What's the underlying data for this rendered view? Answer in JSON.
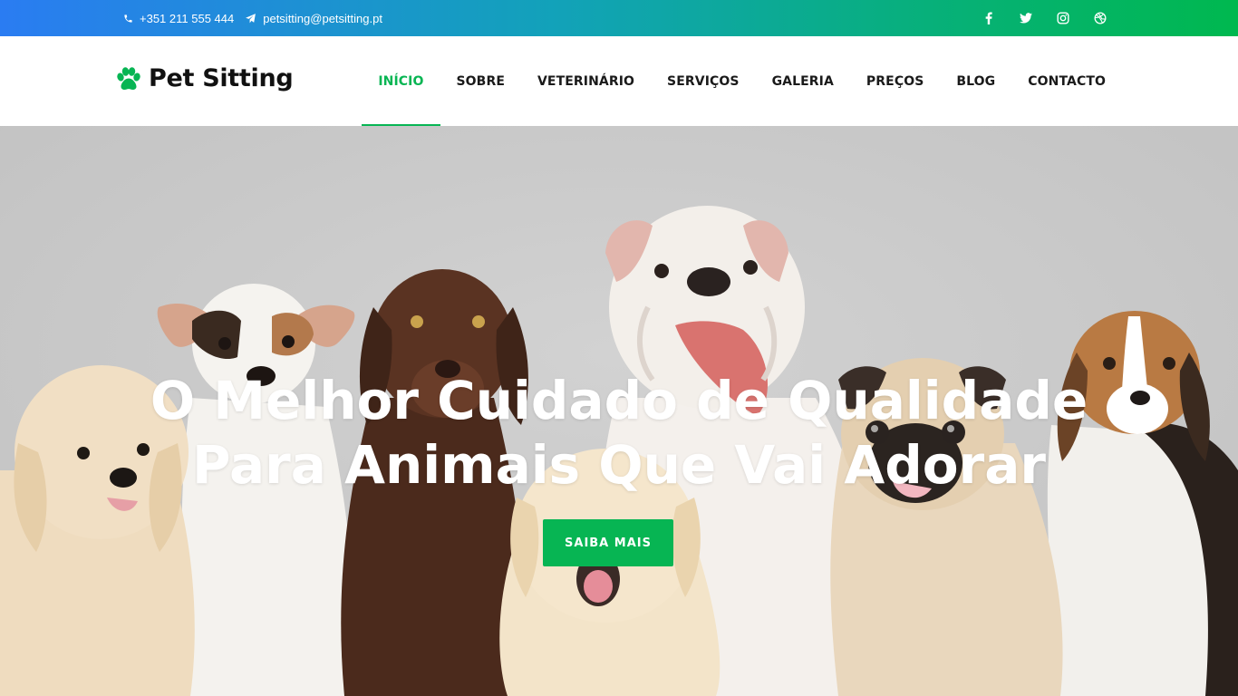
{
  "topbar": {
    "phone": "+351 211 555 444",
    "email": "petsitting@petsitting.pt",
    "social": [
      "facebook-icon",
      "twitter-icon",
      "instagram-icon",
      "dribbble-icon"
    ]
  },
  "header": {
    "logo_text": "Pet Sitting",
    "nav": [
      "INÍCIO",
      "SOBRE",
      "VETERINÁRIO",
      "SERVIÇOS",
      "GALERIA",
      "PREÇOS",
      "BLOG",
      "CONTACTO"
    ],
    "active_nav": "INÍCIO"
  },
  "hero": {
    "title_line1": "O Melhor Cuidado de Qualidade",
    "title_line2": "Para Animais Que Vai Adorar",
    "button_label": "SAIBA MAIS"
  },
  "colors": {
    "accent": "#07b553",
    "gradient_start": "#2a7cf2",
    "gradient_end": "#00b84f",
    "hero_bg": "#c9c9c9"
  }
}
